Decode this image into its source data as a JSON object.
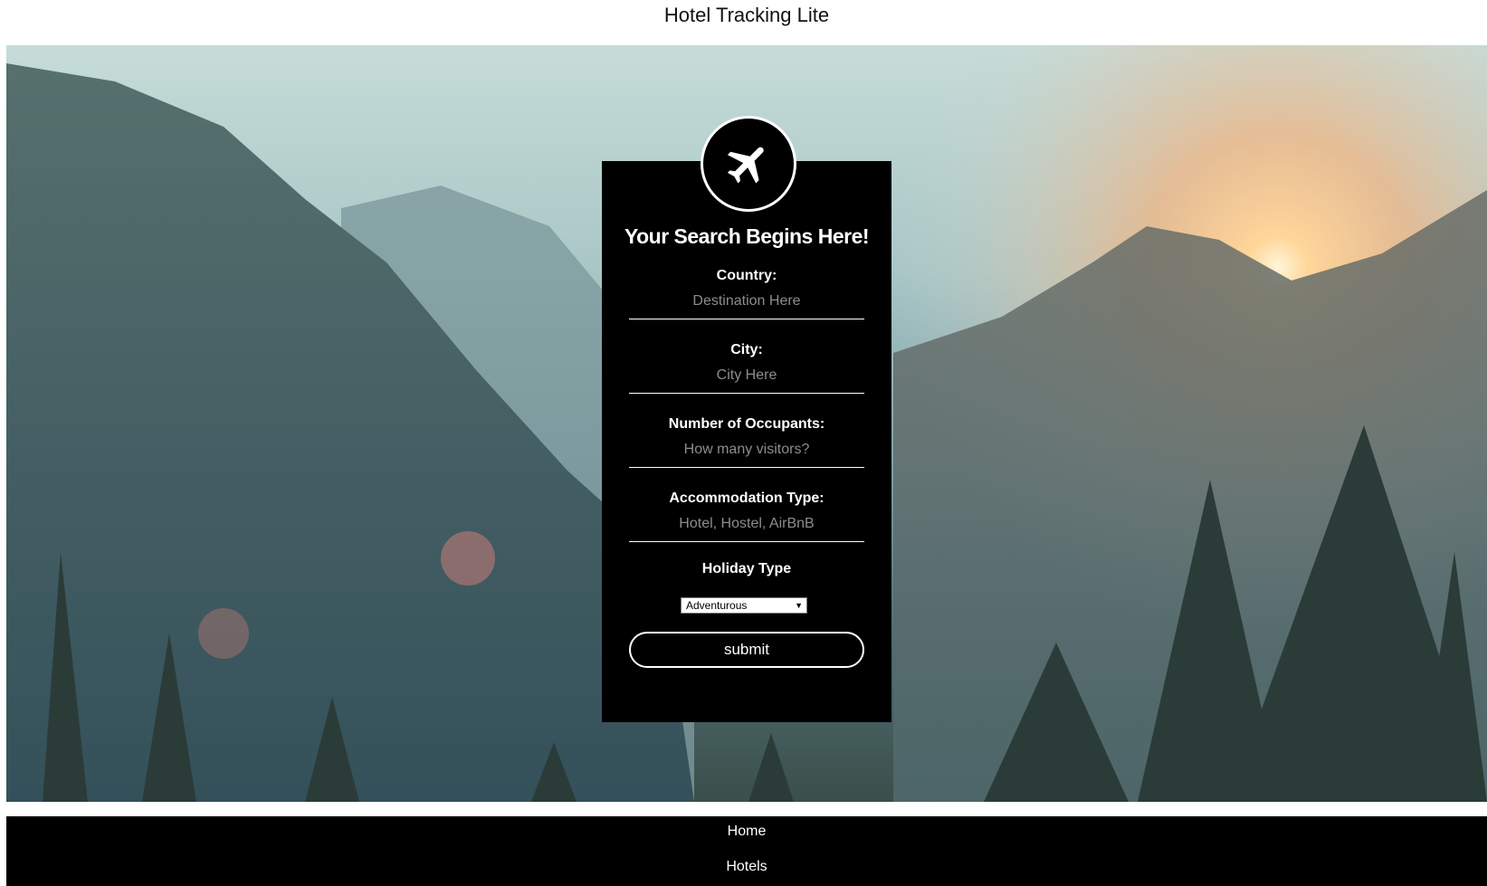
{
  "site": {
    "title": "Hotel Tracking Lite"
  },
  "search": {
    "heading": "Your Search Begins Here!",
    "country_label": "Country:",
    "country_placeholder": "Destination Here",
    "city_label": "City:",
    "city_placeholder": "City Here",
    "occupants_label": "Number of Occupants:",
    "occupants_placeholder": "How many visitors?",
    "accommodation_label": "Accommodation Type:",
    "accommodation_placeholder": "Hotel, Hostel, AirBnB",
    "holiday_label": "Holiday Type",
    "holiday_selected": "Adventurous",
    "submit_label": "submit",
    "logo_icon": "airplane-icon"
  },
  "nav": {
    "items": [
      "Home",
      "Hotels"
    ]
  },
  "colors": {
    "card_bg": "#000000",
    "nav_bg": "#000000",
    "text": "#ffffff"
  }
}
